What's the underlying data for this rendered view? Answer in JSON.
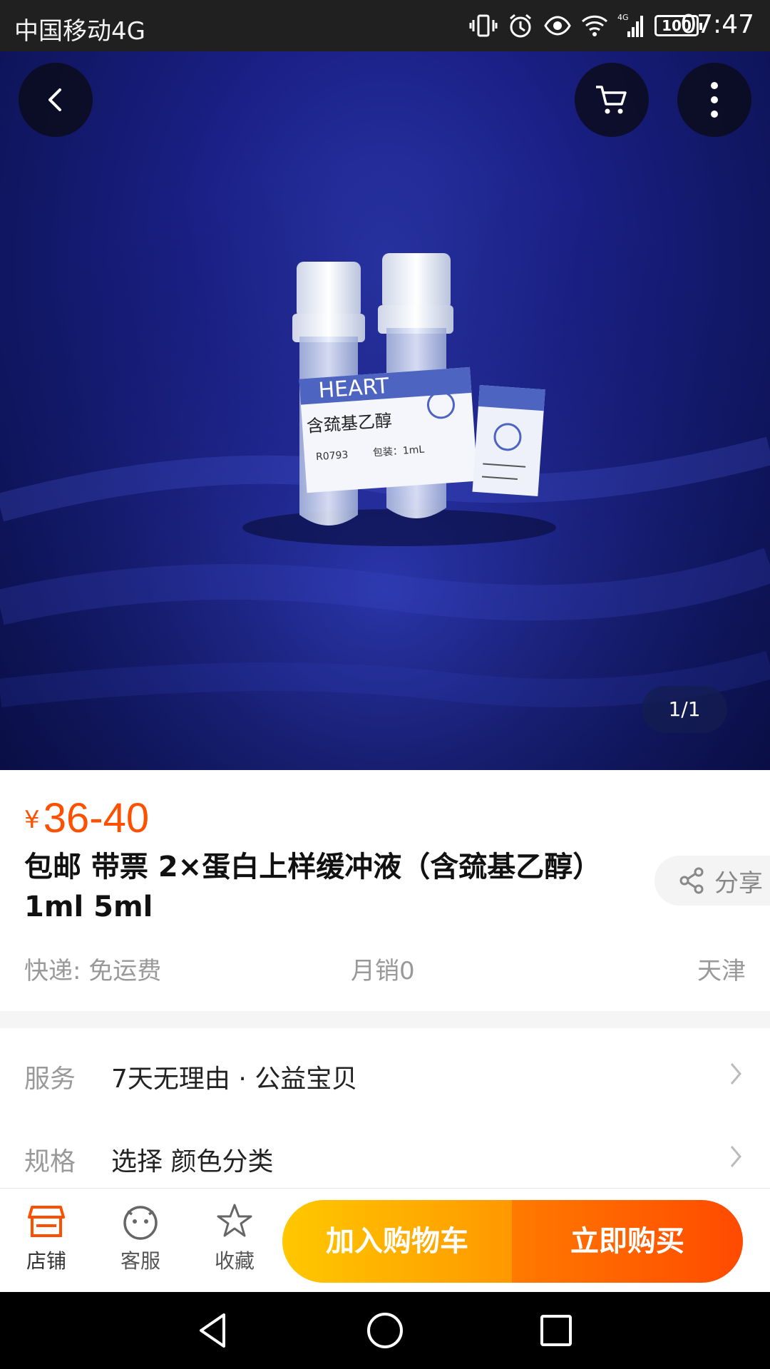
{
  "status_bar": {
    "carrier": "中国移动4G",
    "network_badge": "4G",
    "battery": "100",
    "time": "07:47",
    "icons": [
      "vibrate-icon",
      "alarm-icon",
      "eye-icon",
      "wifi-icon",
      "signal-icon",
      "battery-icon"
    ]
  },
  "hero": {
    "page_indicator": "1/1",
    "label_lines": [
      "HEART",
      "含巯基乙醇",
      "R0793",
      "包装：1mL"
    ]
  },
  "product": {
    "price_symbol": "¥",
    "price": "36-40",
    "title_line1": "包邮 带票 2×蛋白上样缓冲液（含巯基乙醇）",
    "title_line2": "1ml 5ml",
    "share_label": "分享",
    "delivery": "快递: 免运费",
    "sales": "月销0",
    "location": "天津"
  },
  "options": {
    "service_label": "服务",
    "service_value": "7天无理由 · 公益宝贝",
    "spec_label": "规格",
    "spec_value": "选择 颜色分类"
  },
  "action_bar": {
    "shop_label": "店铺",
    "service_label": "客服",
    "favorite_label": "收藏",
    "add_to_cart": "加入购物车",
    "buy_now": "立即购买"
  },
  "colors": {
    "accent": "#ff5000",
    "cart_button": "#ffb400",
    "buy_button": "#ff5a00"
  }
}
